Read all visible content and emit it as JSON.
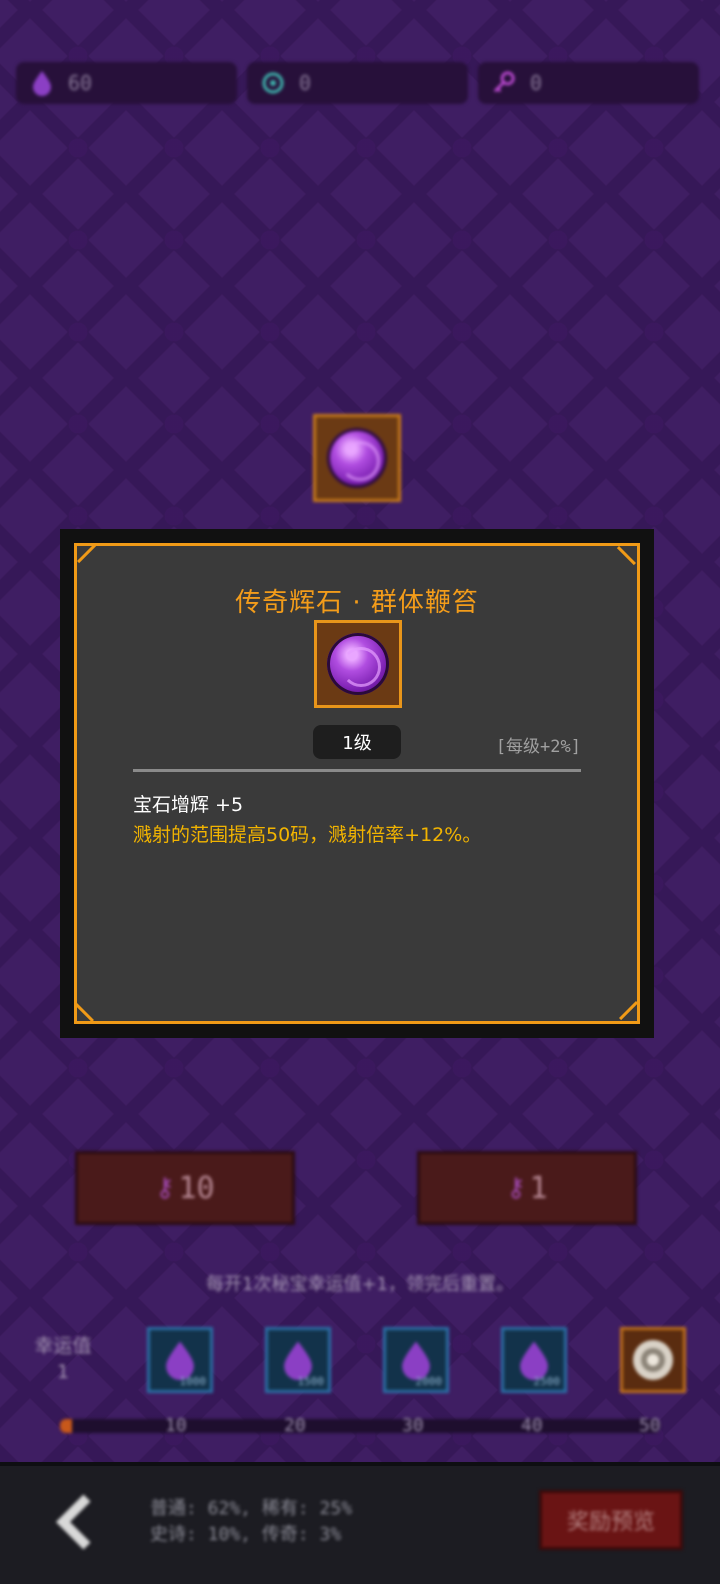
{
  "resources": [
    {
      "icon": "purple-drop-icon",
      "value": "60"
    },
    {
      "icon": "cyan-swirl-icon",
      "value": "0"
    },
    {
      "icon": "magenta-key-icon",
      "value": "0"
    }
  ],
  "dialog": {
    "title": "传奇辉石 · 群体鞭笞",
    "level": "1级",
    "per_level": "[每级+2%]",
    "stat": "宝石增辉 +5",
    "description": "溅射的范围提高50码，溅射倍率+12%。"
  },
  "buttons": {
    "open_ten": "10",
    "open_one": "1"
  },
  "luck": {
    "tip": "每开1次秘宝幸运值+1，领完后重置。",
    "label": "幸运值",
    "value": "1",
    "progress": 0.02,
    "rewards": [
      {
        "icon": "purple-drop-icon",
        "count": "1000"
      },
      {
        "icon": "purple-drop-icon",
        "count": "1500"
      },
      {
        "icon": "purple-drop-icon",
        "count": "2000"
      },
      {
        "icon": "purple-drop-icon",
        "count": "2500"
      },
      {
        "icon": "legendary-gem-icon",
        "count": ""
      }
    ],
    "ticks": [
      "10",
      "20",
      "30",
      "40",
      "50"
    ]
  },
  "bottom": {
    "rates_line1": "普通: 62%, 稀有: 25%",
    "rates_line2": "史诗: 10%, 传奇: 3%",
    "preview_label": "奖励预览"
  },
  "colors": {
    "accent": "#f09a17",
    "description": "#f2b400",
    "background": "#3f1e63"
  }
}
